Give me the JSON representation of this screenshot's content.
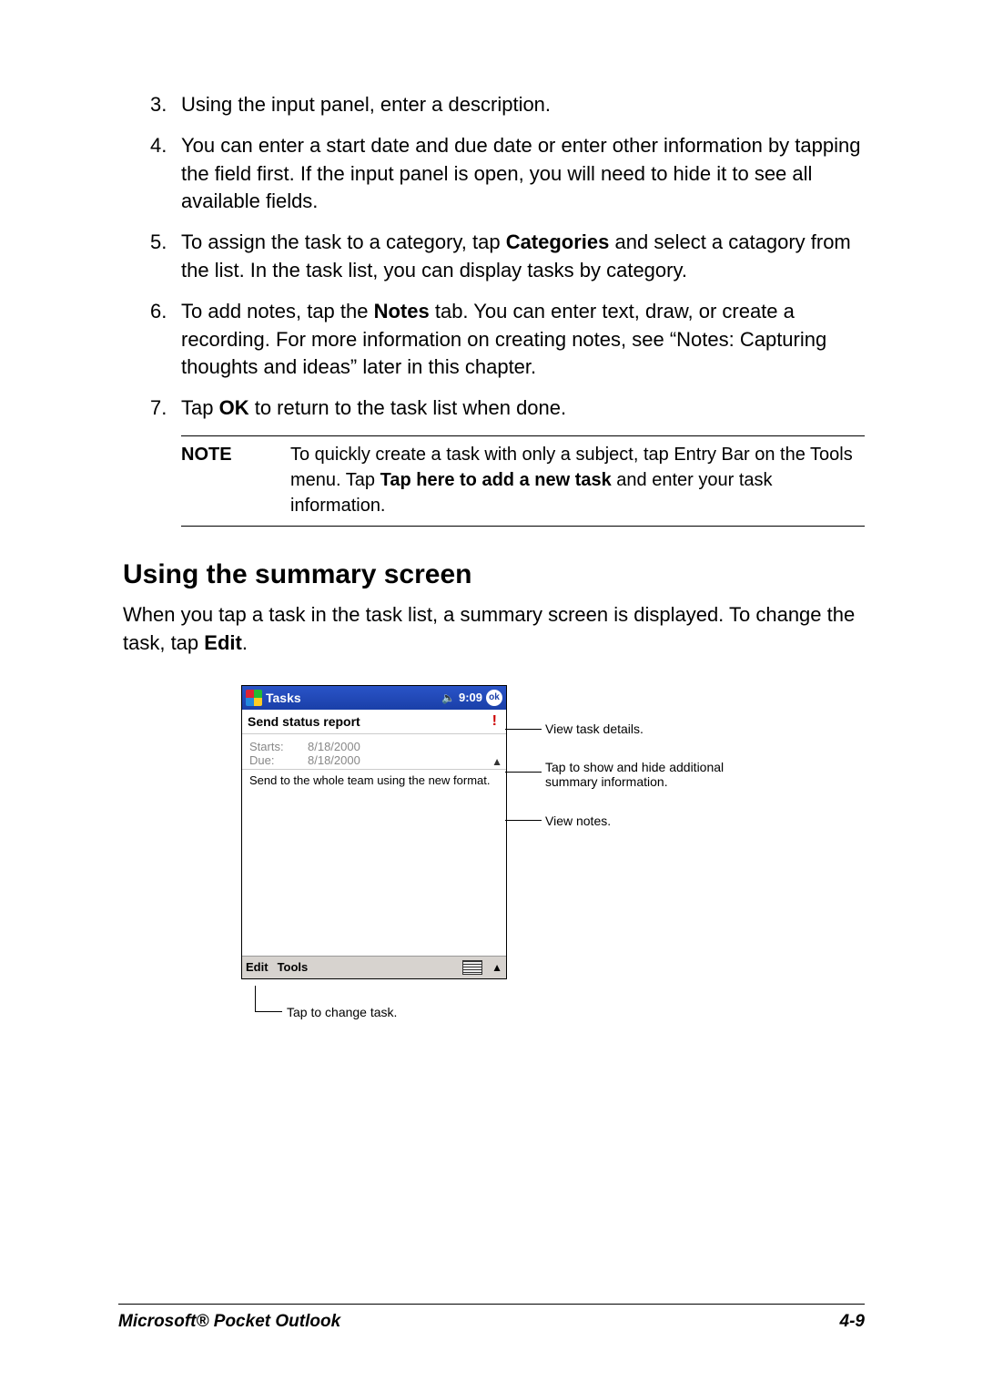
{
  "steps": [
    {
      "num": "3.",
      "parts": [
        "Using the input panel, enter a description."
      ]
    },
    {
      "num": "4.",
      "parts": [
        "You can enter a start date and due date or enter other information by tapping the field first. If the input panel is open, you will need to hide it to see all available fields."
      ]
    },
    {
      "num": "5.",
      "parts": [
        "To assign the task to a category, tap ",
        {
          "b": "Categories"
        },
        " and select a catagory from the list. In the task list, you can display tasks by category."
      ]
    },
    {
      "num": "6.",
      "parts": [
        "To add notes, tap the ",
        {
          "b": "Notes"
        },
        " tab. You can enter text, draw, or create a recording. For more information on creating notes, see “Notes: Capturing thoughts and ideas” later in this chapter."
      ]
    },
    {
      "num": "7.",
      "parts": [
        "Tap ",
        {
          "b": "OK"
        },
        " to return to the task list when done."
      ]
    }
  ],
  "note": {
    "label": "NOTE",
    "parts": [
      "To quickly create a task with only a subject, tap Entry Bar on the Tools menu. Tap ",
      {
        "b": "Tap here to add a new task"
      },
      " and enter your task information."
    ]
  },
  "section_heading": "Using the summary screen",
  "section_body_parts": [
    "When you tap a task in the task list, a summary screen is displayed. To change the task, tap ",
    {
      "b": "Edit"
    },
    "."
  ],
  "device": {
    "app_title": "Tasks",
    "time": "9:09",
    "ok": "ok",
    "subject": "Send status report",
    "starts_label": "Starts:",
    "due_label": "Due:",
    "starts_value": "8/18/2000",
    "due_value": "8/18/2000",
    "notes_text": "Send to the whole team using the new format.",
    "menu_edit": "Edit",
    "menu_tools": "Tools"
  },
  "callouts": {
    "details": "View task details.",
    "toggle": "Tap to show and hide additional summary information.",
    "viewnotes": "View notes.",
    "edit": "Tap to change task."
  },
  "footer": {
    "left": "Microsoft® Pocket Outlook",
    "right": "4-9"
  }
}
